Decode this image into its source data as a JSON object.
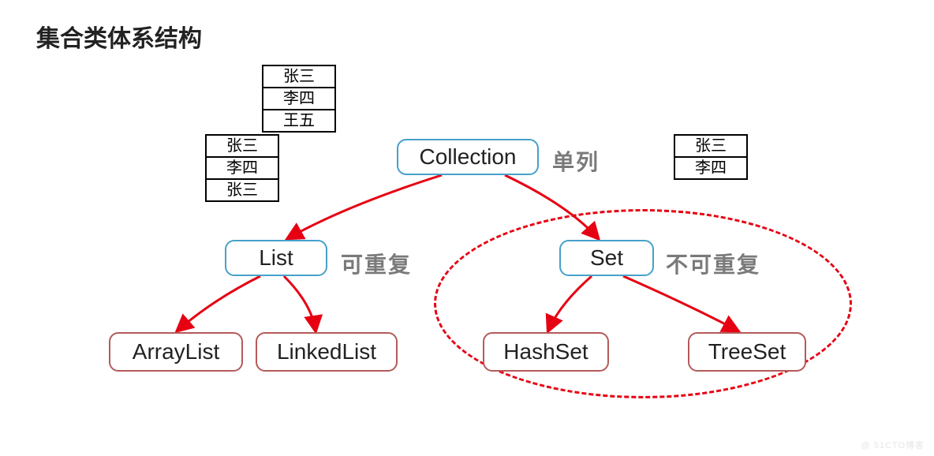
{
  "title": "集合类体系结构",
  "nodes": {
    "collection": "Collection",
    "list": "List",
    "set": "Set",
    "arraylist": "ArrayList",
    "linkedlist": "LinkedList",
    "hashset": "HashSet",
    "treeset": "TreeSet"
  },
  "notes": {
    "single": "单列",
    "repeat": "可重复",
    "norepeat": "不可重复"
  },
  "tables": {
    "left_upper": [
      "张三",
      "李四",
      "王五"
    ],
    "left_lower": [
      "张三",
      "李四",
      "张三"
    ],
    "right": [
      "张三",
      "李四"
    ]
  },
  "watermark": "@ 51CTO博客"
}
